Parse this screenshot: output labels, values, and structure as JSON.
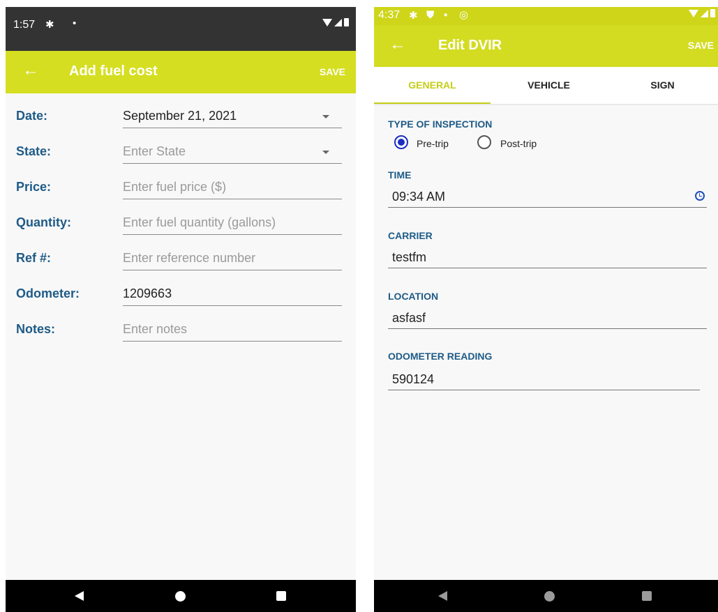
{
  "left": {
    "status": {
      "time": "1:57"
    },
    "appbar": {
      "title": "Add fuel cost",
      "save": "SAVE"
    },
    "fields": [
      {
        "label": "Date:",
        "value": "September 21, 2021",
        "placeholder": ""
      },
      {
        "label": "State:",
        "value": "",
        "placeholder": "Enter State"
      },
      {
        "label": "Price:",
        "value": "",
        "placeholder": "Enter fuel price ($)"
      },
      {
        "label": "Quantity:",
        "value": "",
        "placeholder": "Enter fuel quantity (gallons)"
      },
      {
        "label": "Ref #:",
        "value": "",
        "placeholder": "Enter reference number"
      },
      {
        "label": "Odometer:",
        "value": "1209663",
        "placeholder": ""
      },
      {
        "label": "Notes:",
        "value": "",
        "placeholder": "Enter notes"
      }
    ]
  },
  "right": {
    "status": {
      "time": "4:37"
    },
    "appbar": {
      "title": "Edit DVIR",
      "save": "SAVE"
    },
    "tabs": [
      "GENERAL",
      "VEHICLE",
      "SIGN"
    ],
    "inspection": {
      "label": "TYPE OF INSPECTION",
      "options": [
        "Pre-trip",
        "Post-trip"
      ],
      "selected": "Pre-trip"
    },
    "time": {
      "label": "TIME",
      "value": "09:34 AM"
    },
    "carrier": {
      "label": "CARRIER",
      "value": "testfm"
    },
    "location": {
      "label": "LOCATION",
      "value": "asfasf"
    },
    "odometer": {
      "label": "ODOMETER READING",
      "value": "590124"
    }
  },
  "colors": {
    "appbar": "#d5de21",
    "label": "#1e5b87",
    "radio": "#1a2fc0"
  }
}
